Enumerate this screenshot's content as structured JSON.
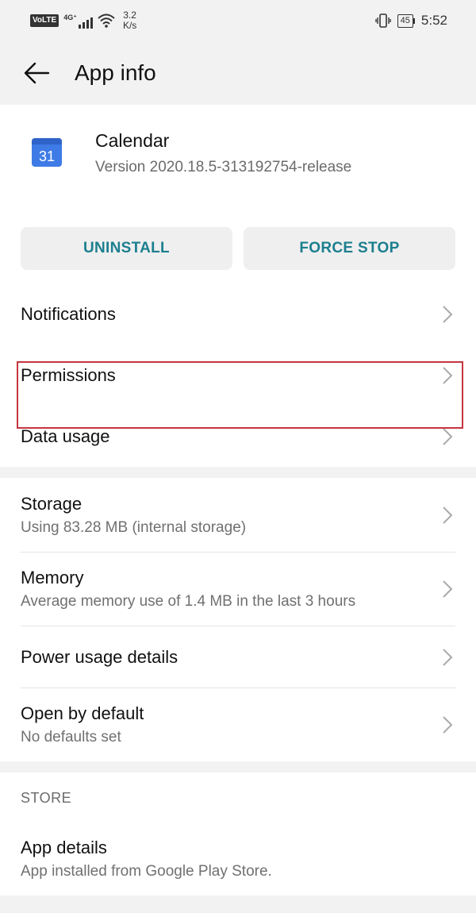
{
  "status_bar": {
    "volte": "VoLTE",
    "network": "4G⁺",
    "speed_value": "3.2",
    "speed_unit": "K/s",
    "battery": "45",
    "time": "5:52"
  },
  "app_bar": {
    "title": "App info",
    "back_icon": "arrow-left-icon"
  },
  "app": {
    "name": "Calendar",
    "version": "Version 2020.18.5-313192754-release",
    "icon_text": "31",
    "icon_color": "#3f7be6"
  },
  "actions": {
    "uninstall": "UNINSTALL",
    "force_stop": "FORCE STOP",
    "accent": "#1c7f8f"
  },
  "settings": {
    "notifications": "Notifications",
    "permissions": "Permissions",
    "data_usage": "Data usage",
    "storage": {
      "label": "Storage",
      "sub": "Using 83.28 MB (internal storage)"
    },
    "memory": {
      "label": "Memory",
      "sub": "Average memory use of 1.4 MB in the last 3 hours"
    },
    "power": "Power usage details",
    "open_default": {
      "label": "Open by default",
      "sub": "No defaults set"
    }
  },
  "store": {
    "header": "STORE",
    "app_details": {
      "label": "App details",
      "sub": "App installed from Google Play Store."
    }
  },
  "highlight_color": "#c6353f"
}
